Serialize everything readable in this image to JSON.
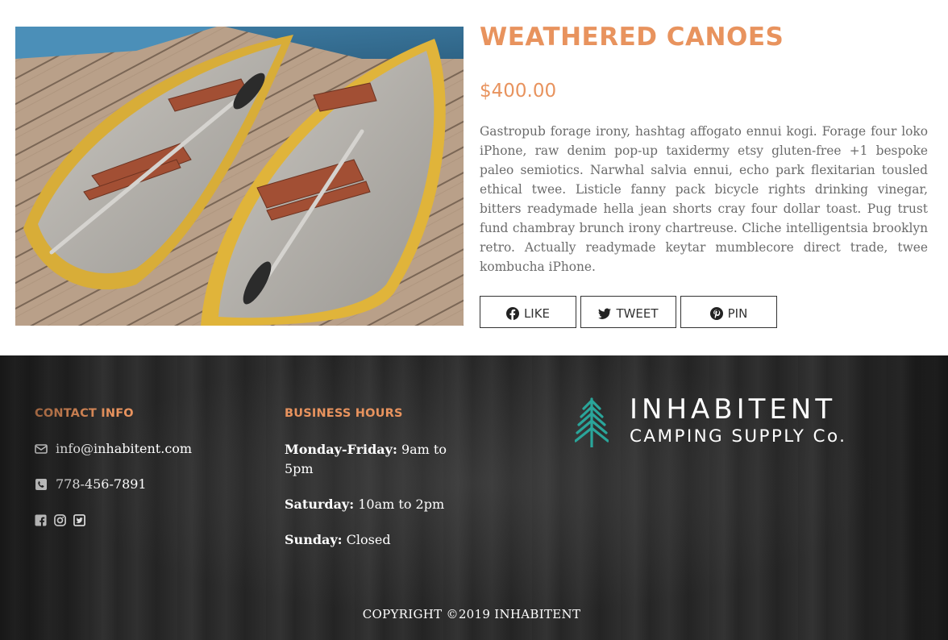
{
  "product": {
    "image_alt": "Two weathered canoes docked",
    "title": "WEATHERED CANOES",
    "price": "$400.00",
    "description": "Gastropub forage irony, hashtag affogato ennui kogi. Forage four loko iPhone, raw denim pop-up taxidermy etsy gluten-free +1 bespoke paleo semiotics. Narwhal salvia ennui, echo park flexitarian tousled ethical twee. Listicle fanny pack bicycle rights drinking vinegar, bitters readymade hella jean shorts cray four dollar toast. Pug trust fund chambray brunch irony chartreuse. Cliche intelligentsia brooklyn retro. Actually readymade keytar mumblecore direct trade, twee kombucha iPhone.",
    "share": {
      "like_label": "LIKE",
      "tweet_label": "TWEET",
      "pin_label": "PIN"
    }
  },
  "footer": {
    "contact": {
      "heading": "CONTACT INFO",
      "email": "info@inhabitent.com",
      "phone": "778-456-7891",
      "social_icons": [
        "facebook-square-icon",
        "instagram-icon",
        "twitter-square-icon"
      ]
    },
    "hours": {
      "heading": "BUSINESS HOURS",
      "weekday_label": "Monday-Friday:",
      "weekday_value": " 9am to 5pm",
      "saturday_label": "Saturday:",
      "saturday_value": " 10am to 2pm",
      "sunday_label": "Sunday:",
      "sunday_value": " Closed"
    },
    "logo": {
      "name": "INHABITENT",
      "sub": "CAMPING SUPPLY Co."
    },
    "copyright": "COPYRIGHT ©2019 INHABITENT"
  },
  "colors": {
    "accent": "#e8935e",
    "logo_tree": "#2aa59a",
    "footer_bg": "#2a2a2a",
    "canoe_yellow": "#e0b43a",
    "seat_wood": "#a24f34",
    "dock_wood": "#b89e86"
  }
}
